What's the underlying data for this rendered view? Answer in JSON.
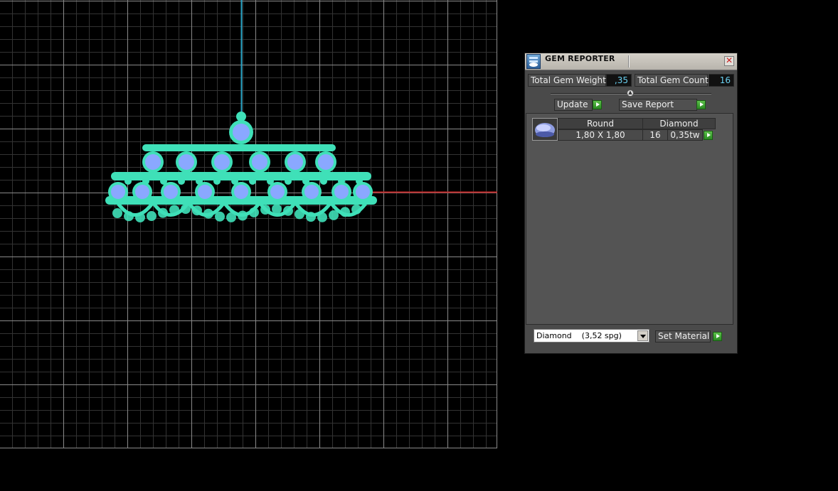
{
  "viewport": {
    "axis_colors": {
      "y_axis": "#2aa6c8",
      "x_axis": "#c02828"
    },
    "model_colors": {
      "metal": "#3fe0b8",
      "gem": "#8aa8ff"
    }
  },
  "panel": {
    "title": "GEM REPORTER",
    "close_icon": "close-icon",
    "total_weight_label": "Total Gem Weight",
    "total_weight_value": ",35",
    "total_count_label": "Total Gem Count",
    "total_count_value": "16",
    "update_label": "Update",
    "save_report_label": "Save Report",
    "table": {
      "headers": [
        "Round",
        "Diamond"
      ],
      "rows": [
        {
          "size": "1,80 X 1,80",
          "count": "16",
          "weight": "0,35tw"
        }
      ]
    },
    "material_select": "Diamond    (3,52 spg)",
    "set_material_label": "Set Material"
  }
}
